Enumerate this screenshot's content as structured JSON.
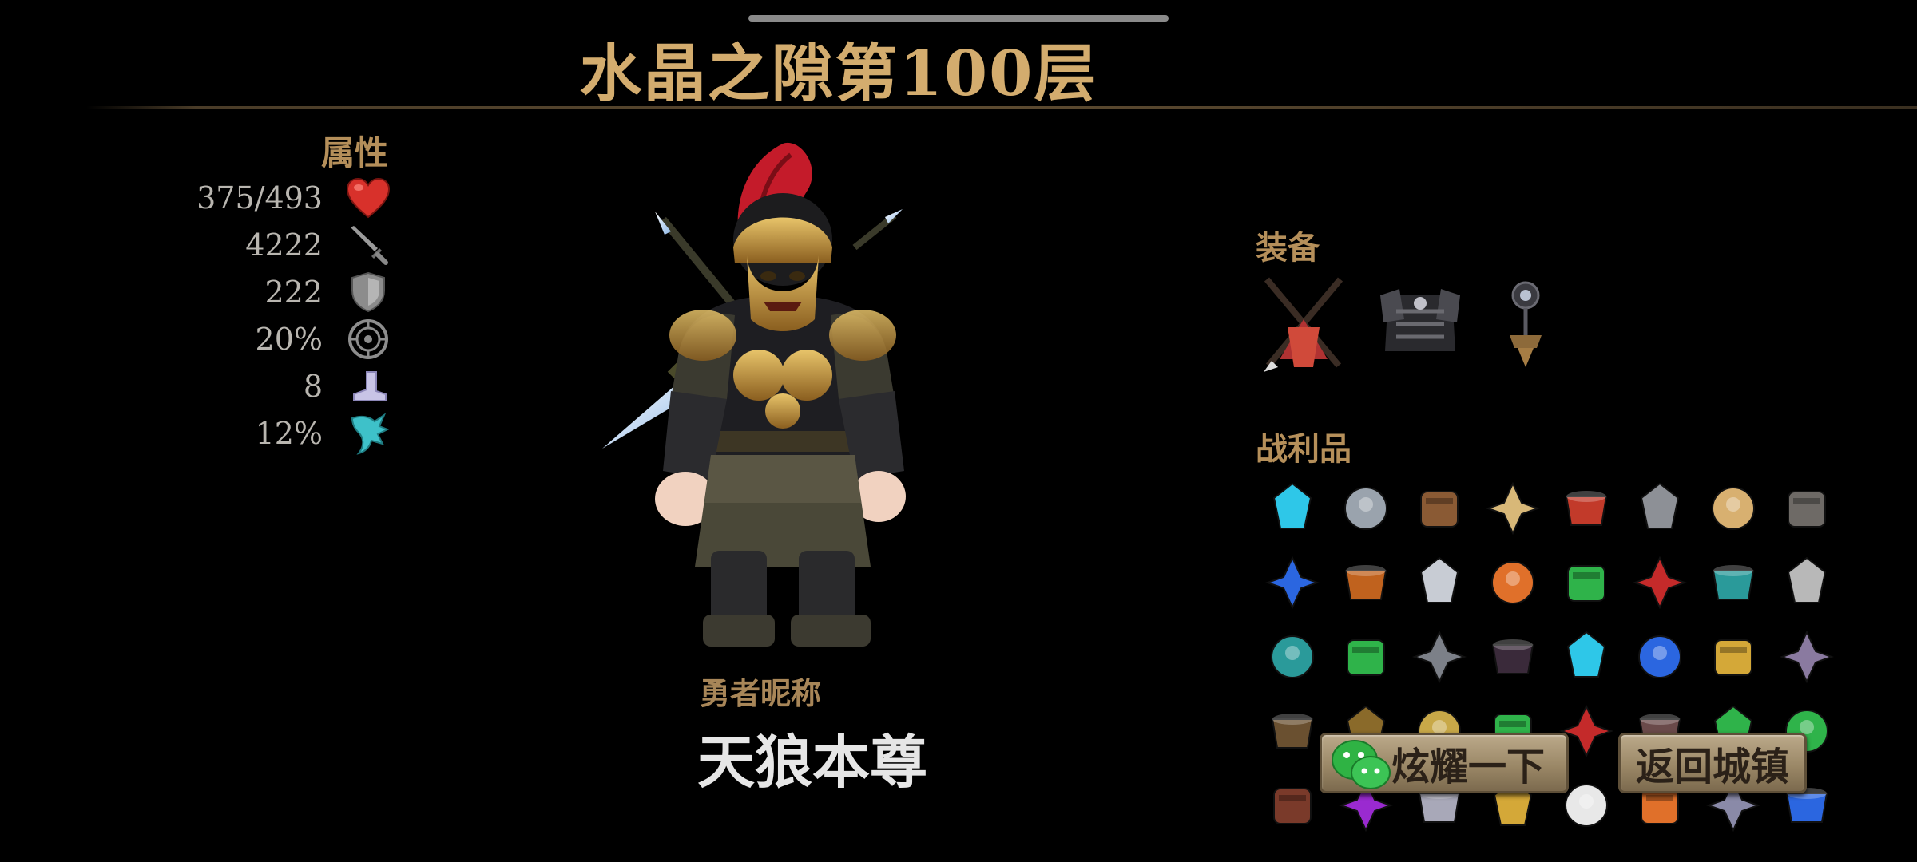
{
  "header": {
    "title": "水晶之隙第100层"
  },
  "stats": {
    "label": "属性",
    "rows": [
      {
        "value": "375/493",
        "icon": "heart-icon"
      },
      {
        "value": "4222",
        "icon": "sword-icon"
      },
      {
        "value": "222",
        "icon": "shield-icon"
      },
      {
        "value": "20%",
        "icon": "critical-icon"
      },
      {
        "value": "8",
        "icon": "boot-icon"
      },
      {
        "value": "12%",
        "icon": "lifesteal-claw-icon"
      }
    ]
  },
  "hero": {
    "nickname_label": "勇者昵称",
    "nickname": "天狼本尊"
  },
  "equipment": {
    "label": "装备",
    "items": [
      "crossed-spears-icon",
      "dark-armor-icon",
      "amulet-icon"
    ]
  },
  "loot": {
    "label": "战利品",
    "items": [
      "cyan-crystal-icon",
      "steel-helm-icon",
      "brown-cape-icon",
      "scroll-icon",
      "shuriken-icon",
      "stone-rune-icon",
      "pig-pet-icon",
      "backpack-icon",
      "blue-gem-icon",
      "orange-hood-icon",
      "silver-hook-icon",
      "fire-amulet-icon",
      "green-gem-icon",
      "red-gear-icon",
      "teal-cloak-icon",
      "ring-icon",
      "teal-bracer-icon",
      "green-bowl-icon",
      "iron-helm-icon",
      "dark-mask-icon",
      "cyan-wings-icon",
      "blue-crystal-icon",
      "gold-ring-icon",
      "book-icon",
      "leather-pack-icon",
      "bat-icon",
      "bell-icon",
      "green-urn-icon",
      "red-crystal-icon",
      "horned-mask-icon",
      "green-lamp-icon",
      "green-shell-icon",
      "spiked-collar-icon",
      "purple-crate-icon",
      "sword-hilt-icon",
      "gold-coin-icon",
      "white-skull-icon",
      "fire-beast-icon",
      "staff-icon",
      "blue-spike-icon"
    ]
  },
  "buttons": {
    "share": "炫耀一下",
    "return": "返回城镇"
  },
  "colors": {
    "accent": "#c9a36c",
    "button": "#9b8867",
    "background": "#000000"
  }
}
